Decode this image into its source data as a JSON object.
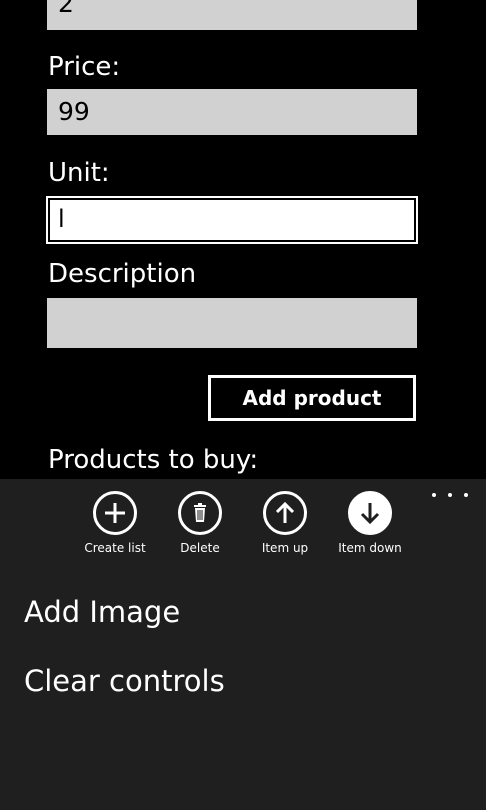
{
  "form": {
    "quantity_value": "2",
    "price_label": "Price:",
    "price_value": "99",
    "unit_label": "Unit:",
    "unit_value": "l",
    "description_label": "Description",
    "description_value": "",
    "add_product_label": "Add product",
    "products_heading": "Products to buy:"
  },
  "appbar": {
    "buttons": [
      {
        "label": "Create list",
        "icon": "plus-icon"
      },
      {
        "label": "Delete",
        "icon": "trash-icon"
      },
      {
        "label": "Item up",
        "icon": "arrow-up-icon"
      },
      {
        "label": "Item down",
        "icon": "arrow-down-icon"
      }
    ],
    "more_icon": "ellipsis-icon",
    "menu_items": [
      "Add Image",
      "Clear controls"
    ]
  },
  "colors": {
    "background": "#000000",
    "textbox": "#d1d1d1",
    "appbar": "#1f1f1f",
    "foreground": "#ffffff"
  }
}
